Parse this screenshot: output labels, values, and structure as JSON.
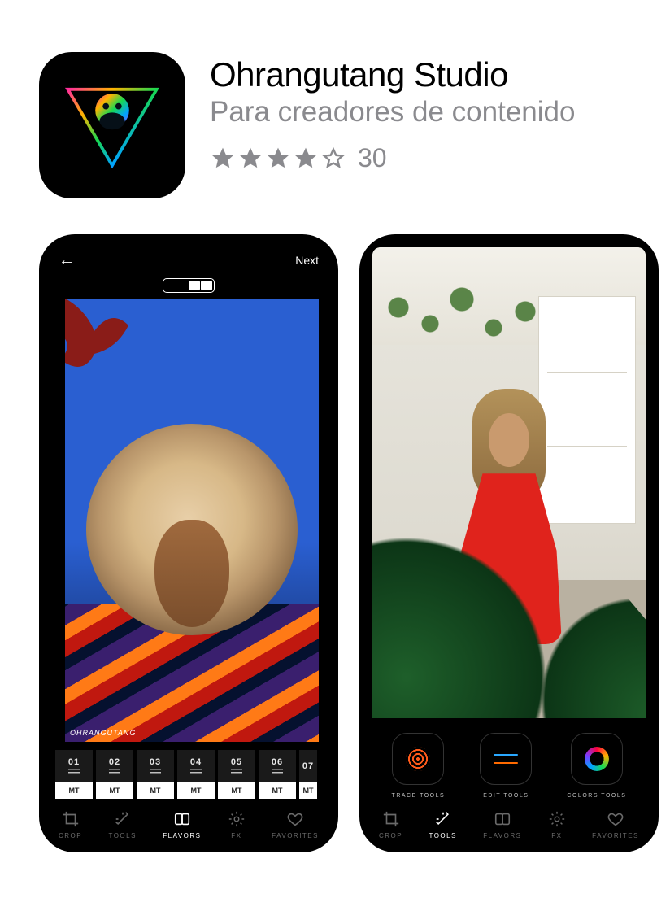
{
  "app": {
    "title": "Ohrangutang Studio",
    "subtitle": "Para creadores de contenido",
    "rating_stars_filled": 4,
    "rating_stars_total": 5,
    "rating_count": "30"
  },
  "screenshot1": {
    "nav": {
      "back_icon": "←",
      "next_label": "Next"
    },
    "preview": {
      "watermark": "OHRANGUTANG"
    },
    "filters": [
      {
        "num": "01",
        "code": "MT"
      },
      {
        "num": "02",
        "code": "MT"
      },
      {
        "num": "03",
        "code": "MT"
      },
      {
        "num": "04",
        "code": "MT"
      },
      {
        "num": "05",
        "code": "MT"
      },
      {
        "num": "06",
        "code": "MT"
      },
      {
        "num": "07",
        "code": "MT"
      }
    ],
    "tabs": [
      {
        "label": "CROP"
      },
      {
        "label": "TOOLS"
      },
      {
        "label": "FLAVORS"
      },
      {
        "label": "FX"
      },
      {
        "label": "FAVORITES"
      }
    ],
    "active_tab_index": 2
  },
  "screenshot2": {
    "toolbuttons": [
      {
        "label": "TRACE TOOLS"
      },
      {
        "label": "EDIT TOOLS"
      },
      {
        "label": "COLORS TOOLS"
      }
    ],
    "tabs": [
      {
        "label": "CROP"
      },
      {
        "label": "TOOLS"
      },
      {
        "label": "FLAVORS"
      },
      {
        "label": "FX"
      },
      {
        "label": "FAVORITES"
      }
    ],
    "active_tab_index": 1
  }
}
